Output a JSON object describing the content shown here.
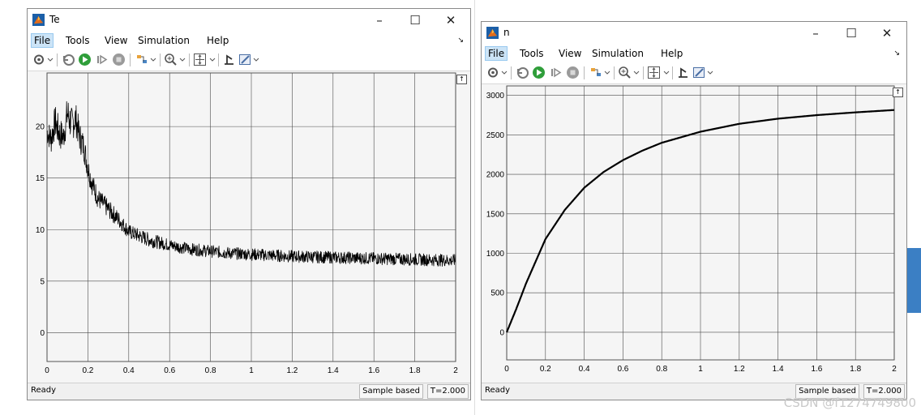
{
  "windows": [
    {
      "title": "Te",
      "menu": [
        "File",
        "Tools",
        "View",
        "Simulation",
        "Help"
      ],
      "status": {
        "ready": "Ready",
        "mode": "Sample based",
        "time": "T=2.000"
      }
    },
    {
      "title": "n",
      "menu": [
        "File",
        "Tools",
        "View",
        "Simulation",
        "Help"
      ],
      "status": {
        "ready": "Ready",
        "mode": "Sample based",
        "time": "T=2.000"
      }
    }
  ],
  "window_controls": {
    "minimize": "–",
    "maximize": "☐",
    "close": "✕"
  },
  "watermark": "CSDN @f1274749800",
  "icons": [
    "settings-icon",
    "step-back-icon",
    "run-icon",
    "step-forward-icon",
    "stop-icon",
    "highlight-icon",
    "zoom-icon",
    "fit-view-icon",
    "cursor-measure-icon",
    "style-icon"
  ],
  "colors": {
    "accent": "#cce4f7",
    "run_green": "#2f9e3a",
    "plot_bg": "#f5f5f5",
    "trace": "#000000"
  },
  "chart_data": [
    {
      "type": "line",
      "title": "",
      "x_ticks": [
        "0",
        "0.2",
        "0.4",
        "0.6",
        "0.8",
        "1",
        "1.2",
        "1.4",
        "1.6",
        "1.8",
        "2"
      ],
      "y_ticks": [
        "0",
        "5",
        "10",
        "15",
        "20"
      ],
      "xlim": [
        0,
        2
      ],
      "ylim": [
        -2.8,
        25.2
      ],
      "grid": true,
      "series": [
        {
          "x": [
            0,
            0.02,
            0.04,
            0.06,
            0.08,
            0.1,
            0.12,
            0.14,
            0.16,
            0.18,
            0.2,
            0.22,
            0.25,
            0.3,
            0.35,
            0.4,
            0.5,
            0.6,
            0.7,
            0.8,
            0.9,
            1.0,
            1.2,
            1.4,
            1.6,
            1.8,
            2.0
          ],
          "y": [
            19.5,
            18.8,
            20.5,
            19.3,
            19.0,
            21.3,
            20.2,
            20.8,
            19.0,
            18.0,
            16.0,
            14.5,
            13.0,
            12.0,
            11.0,
            9.8,
            9.0,
            8.5,
            8.1,
            7.9,
            7.7,
            7.6,
            7.4,
            7.3,
            7.2,
            7.1,
            7.0
          ],
          "noise": [
            1.2,
            1.5,
            1.6,
            1.6,
            1.5,
            1.8,
            1.7,
            1.6,
            1.5,
            1.4,
            1.2,
            1.1,
            1.0,
            0.9,
            0.8,
            0.7,
            0.7,
            0.6,
            0.6,
            0.6,
            0.6,
            0.6,
            0.6,
            0.6,
            0.6,
            0.6,
            0.6
          ]
        }
      ]
    },
    {
      "type": "line",
      "title": "",
      "x_ticks": [
        "0",
        "0.2",
        "0.4",
        "0.6",
        "0.8",
        "1",
        "1.2",
        "1.4",
        "1.6",
        "1.8",
        "2"
      ],
      "y_ticks": [
        "0",
        "500",
        "1000",
        "1500",
        "2000",
        "2500",
        "3000"
      ],
      "xlim": [
        0,
        2
      ],
      "ylim": [
        -350,
        3120
      ],
      "grid": true,
      "series": [
        {
          "x": [
            0,
            0.05,
            0.1,
            0.15,
            0.2,
            0.3,
            0.4,
            0.5,
            0.6,
            0.7,
            0.8,
            0.9,
            1.0,
            1.2,
            1.4,
            1.6,
            1.8,
            2.0
          ],
          "y": [
            0,
            300,
            620,
            900,
            1180,
            1550,
            1830,
            2030,
            2180,
            2300,
            2400,
            2470,
            2540,
            2640,
            2705,
            2750,
            2785,
            2815
          ],
          "noise": [
            0,
            0,
            0,
            0,
            0,
            0,
            0,
            0,
            0,
            0,
            0,
            0,
            0,
            0,
            0,
            0,
            0,
            0
          ]
        }
      ]
    }
  ]
}
